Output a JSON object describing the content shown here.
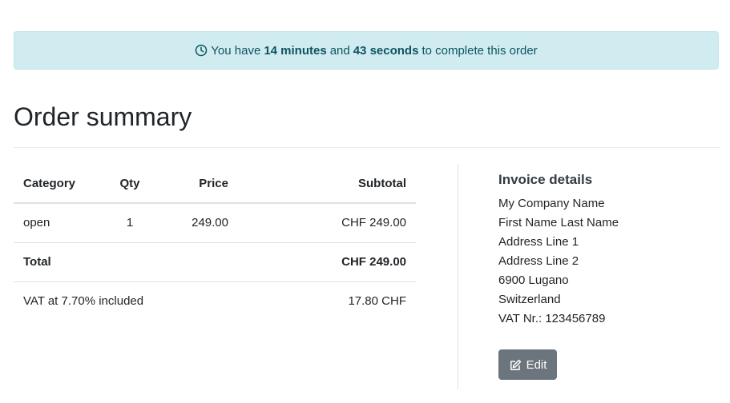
{
  "timer": {
    "prefix": "You have",
    "minutes": "14 minutes",
    "joiner": "and",
    "seconds": "43 seconds",
    "suffix": "to complete this order",
    "icon": "clock-icon"
  },
  "page": {
    "title": "Order summary"
  },
  "order_table": {
    "headers": {
      "category": "Category",
      "qty": "Qty",
      "price": "Price",
      "subtotal": "Subtotal"
    },
    "rows": [
      {
        "category": "open",
        "qty": "1",
        "price": "249.00",
        "subtotal": "CHF 249.00"
      }
    ],
    "total": {
      "label": "Total",
      "value": "CHF 249.00"
    },
    "vat": {
      "label": "VAT at 7.70% included",
      "value": "17.80 CHF"
    }
  },
  "invoice": {
    "heading": "Invoice details",
    "lines": [
      "My Company Name",
      "First Name Last Name",
      "Address Line 1",
      "Address Line 2",
      "6900 Lugano",
      "Switzerland",
      "VAT Nr.: 123456789"
    ],
    "edit_label": "Edit",
    "edit_icon": "edit-icon"
  },
  "colors": {
    "alert_bg": "#d1ecf1",
    "alert_text": "#0c5460",
    "button_bg": "#6c757d"
  }
}
